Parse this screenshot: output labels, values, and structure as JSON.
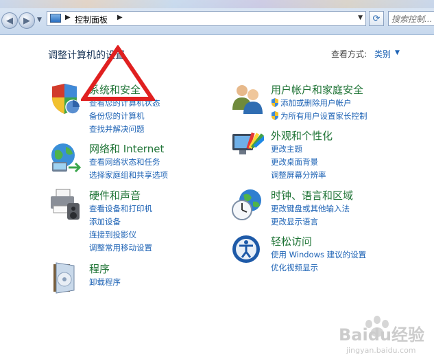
{
  "breadcrumb": {
    "path": "控制面板"
  },
  "search": {
    "placeholder": "搜索控制..."
  },
  "header": {
    "title": "调整计算机的设置",
    "view_by_label": "查看方式:",
    "view_by_value": "类别"
  },
  "categories": [
    {
      "title": "系统和安全",
      "icon": "shield-pie-icon",
      "links": [
        "查看您的计算机状态",
        "备份您的计算机",
        "查找并解决问题"
      ]
    },
    {
      "title": "网络和 Internet",
      "icon": "network-globe-icon",
      "links": [
        "查看网络状态和任务",
        "选择家庭组和共享选项"
      ]
    },
    {
      "title": "硬件和声音",
      "icon": "printer-speaker-icon",
      "links": [
        "查看设备和打印机",
        "添加设备",
        "连接到投影仪",
        "调整常用移动设置"
      ]
    },
    {
      "title": "程序",
      "icon": "programs-box-icon",
      "links": [
        "卸载程序"
      ]
    },
    {
      "title": "用户帐户和家庭安全",
      "icon": "users-icon",
      "links": [
        "添加或删除用户帐户",
        "为所有用户设置家长控制"
      ]
    },
    {
      "title": "外观和个性化",
      "icon": "monitor-palette-icon",
      "links": [
        "更改主题",
        "更改桌面背景",
        "调整屏幕分辨率"
      ]
    },
    {
      "title": "时钟、语言和区域",
      "icon": "clock-globe-icon",
      "links": [
        "更改键盘或其他输入法",
        "更改显示语言"
      ]
    },
    {
      "title": "轻松访问",
      "icon": "ease-of-access-icon",
      "links": [
        "使用 Windows 建议的设置",
        "优化视频显示"
      ]
    }
  ],
  "watermark": {
    "text": "Baidu经验",
    "url": "jingyan.baidu.com"
  },
  "colors": {
    "category_title": "#1e7335",
    "link": "#1e63b5",
    "annotation": "#e02020"
  }
}
